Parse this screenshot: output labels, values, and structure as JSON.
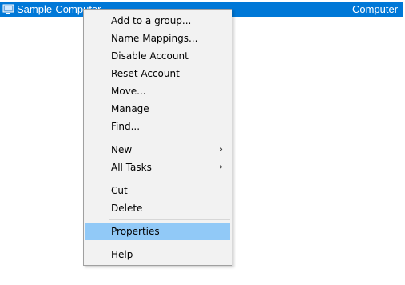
{
  "list_row": {
    "name": "Sample-Computer",
    "type": "Computer"
  },
  "context_menu": {
    "groups": [
      [
        {
          "label": "Add to a group..."
        },
        {
          "label": "Name Mappings..."
        },
        {
          "label": "Disable Account"
        },
        {
          "label": "Reset Account"
        },
        {
          "label": "Move..."
        },
        {
          "label": "Manage"
        },
        {
          "label": "Find..."
        }
      ],
      [
        {
          "label": "New",
          "submenu": "›"
        },
        {
          "label": "All Tasks",
          "submenu": "›"
        }
      ],
      [
        {
          "label": "Cut"
        },
        {
          "label": "Delete"
        }
      ],
      [
        {
          "label": "Properties",
          "highlighted": true
        }
      ],
      [
        {
          "label": "Help"
        }
      ]
    ]
  },
  "colors": {
    "selection_row": "#0078d7",
    "menu_background": "#f2f2f2",
    "menu_highlight": "#91c9f7"
  }
}
